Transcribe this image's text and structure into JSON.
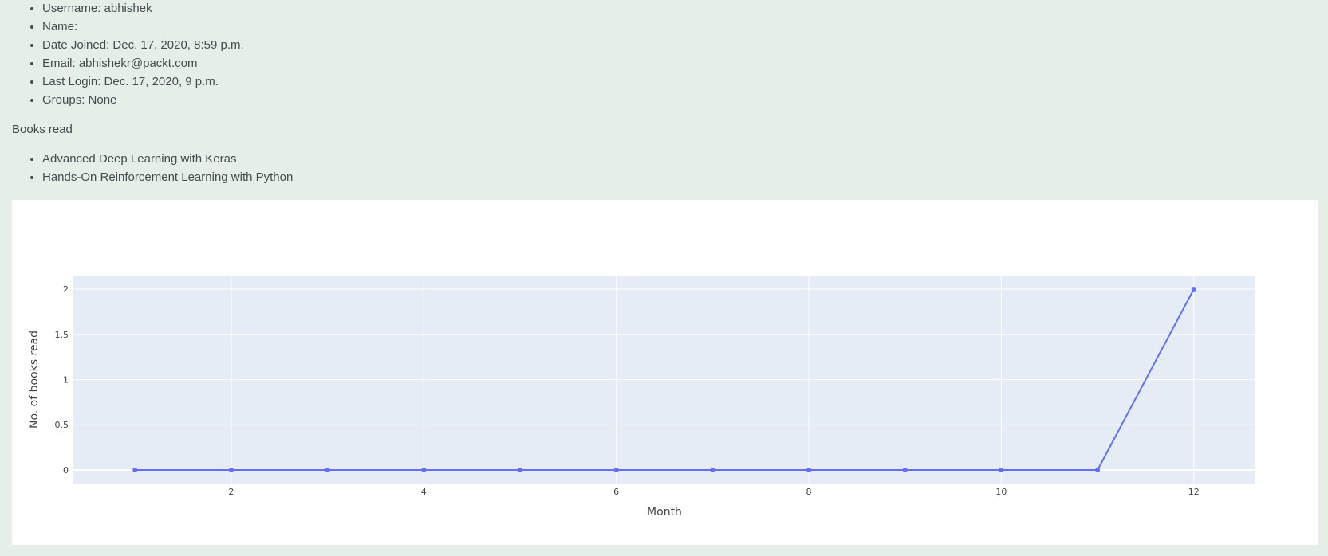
{
  "profile": {
    "items": [
      "Username: abhishek",
      "Name:",
      "Date Joined: Dec. 17, 2020, 8:59 p.m.",
      "Email: abhishekr@packt.com",
      "Last Login: Dec. 17, 2020, 9 p.m.",
      "Groups: None"
    ]
  },
  "books": {
    "heading": "Books read",
    "items": [
      "Advanced Deep Learning with Keras",
      "Hands-On Reinforcement Learning with Python"
    ]
  },
  "colors": {
    "page_background": "#e5efe7",
    "plot_background": "#e5ecf6",
    "line": "#636efa"
  },
  "chart_data": {
    "type": "line",
    "title": "",
    "xlabel": "Month",
    "ylabel": "No. of books read",
    "x": [
      1,
      2,
      3,
      4,
      5,
      6,
      7,
      8,
      9,
      10,
      11,
      12
    ],
    "series": [
      {
        "values": [
          0,
          0,
          0,
          0,
          0,
          0,
          0,
          0,
          0,
          0,
          0,
          2
        ]
      }
    ],
    "xticks": [
      "2",
      "4",
      "6",
      "8",
      "10",
      "12"
    ],
    "yticks": [
      "0",
      "0.5",
      "1",
      "1.5",
      "2"
    ],
    "xlim": [
      0.36,
      12.64
    ],
    "ylim": [
      -0.15,
      2.15
    ],
    "grid": true,
    "markers": true
  }
}
